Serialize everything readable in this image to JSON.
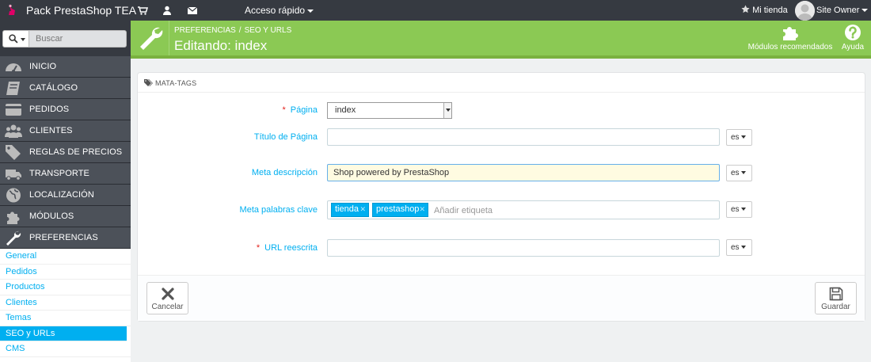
{
  "topbar": {
    "brand": "Pack PrestaShop TEA",
    "quick_access": "Acceso rápido",
    "my_shop": "Mi tienda",
    "user": "Site Owner"
  },
  "sidebar": {
    "search_placeholder": "Buscar",
    "items": [
      {
        "label": "INICIO",
        "icon": "dashboard-icon"
      },
      {
        "label": "CATÁLOGO",
        "icon": "book-icon"
      },
      {
        "label": "PEDIDOS",
        "icon": "credit-card-icon"
      },
      {
        "label": "CLIENTES",
        "icon": "users-icon"
      },
      {
        "label": "REGLAS DE PRECIOS",
        "icon": "tags-icon"
      },
      {
        "label": "TRANSPORTE",
        "icon": "truck-icon"
      },
      {
        "label": "LOCALIZACIÓN",
        "icon": "globe-icon"
      },
      {
        "label": "MÓDULOS",
        "icon": "puzzle-icon"
      },
      {
        "label": "PREFERENCIAS",
        "icon": "wrench-icon"
      }
    ],
    "subitems": [
      "General",
      "Pedidos",
      "Productos",
      "Clientes",
      "Temas",
      "SEO y URLs",
      "CMS"
    ]
  },
  "header": {
    "breadcrumb": [
      "PREFERENCIAS",
      "SEO Y URLS"
    ],
    "breadcrumb_sep": "/",
    "title": "Editando: index",
    "recommended_modules": "Módulos recomendados",
    "help": "Ayuda"
  },
  "panel": {
    "title": "MATA-TAGS",
    "fields": {
      "page_label": "Página",
      "page_value": "index",
      "title_label": "Título de Página",
      "title_value": "",
      "desc_label": "Meta descripción",
      "desc_value": "Shop powered by PrestaShop",
      "keywords_label": "Meta palabras clave",
      "keywords": [
        "tienda",
        "prestashop"
      ],
      "keywords_placeholder": "Añadir etiqueta",
      "url_label": "URL reescrita",
      "url_value": "",
      "lang": "es",
      "required_mark": "*"
    },
    "cancel": "Cancelar",
    "save": "Guardar"
  },
  "colors": {
    "header_green": "#8bc954",
    "accent_blue": "#00aff0",
    "sidebar_dark": "#363a41",
    "required_red": "#e3211b"
  }
}
